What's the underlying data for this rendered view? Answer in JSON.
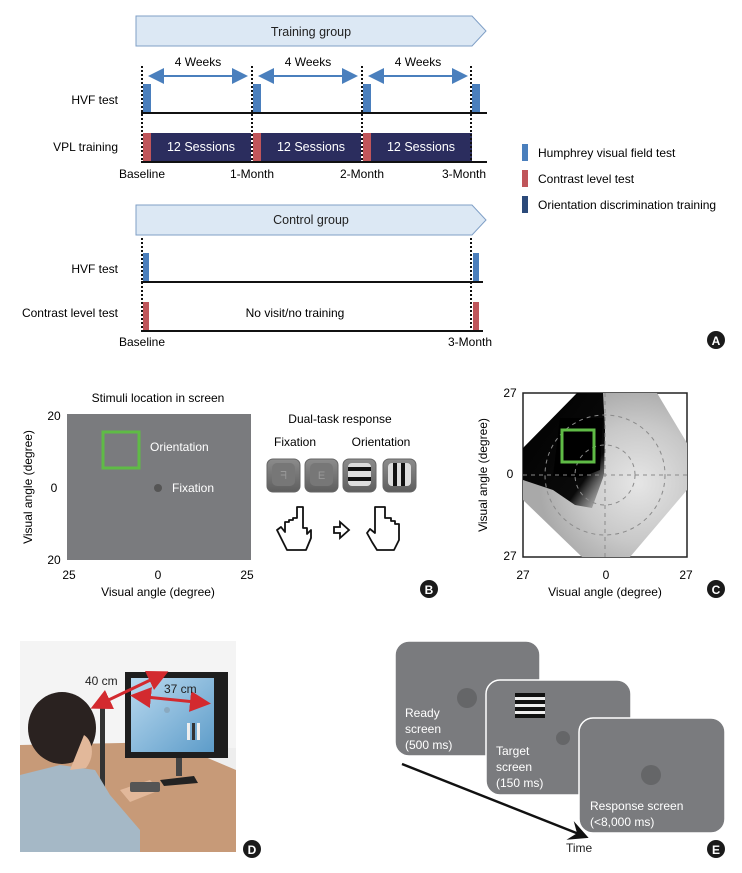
{
  "colors": {
    "hvf": "#4a7fbd",
    "contrast": "#c0555a",
    "training": "#2b2d5e",
    "banner_fill": "#dce8f4",
    "banner_stroke": "#7f9fc6",
    "arrow": "#4a7fbd",
    "screen_gray": "#7a7b7e",
    "green_box": "#5fbb46",
    "red_arrow": "#d32a2f",
    "badge": "#1a1a1a"
  },
  "panel_a": {
    "badge": "A",
    "training": {
      "banner": "Training group",
      "intervals": [
        "4 Weeks",
        "4 Weeks",
        "4 Weeks"
      ],
      "rows": [
        "HVF test",
        "VPL training"
      ],
      "sessions": [
        "12 Sessions",
        "12 Sessions",
        "12 Sessions"
      ],
      "timepoints": [
        "Baseline",
        "1-Month",
        "2-Month",
        "3-Month"
      ]
    },
    "control": {
      "banner": "Control group",
      "rows": [
        "HVF test",
        "Contrast level test"
      ],
      "middle_text": "No visit/no training",
      "timepoints": [
        "Baseline",
        "3-Month"
      ]
    },
    "legend": [
      {
        "label": "Humphrey visual field test",
        "color_key": "hvf"
      },
      {
        "label": "Contrast level test",
        "color_key": "contrast"
      },
      {
        "label": "Orientation discrimination training",
        "color_key": "training"
      }
    ]
  },
  "panel_b": {
    "badge": "B",
    "title": "Stimuli location in screen",
    "ylabel": "Visual angle (degree)",
    "xlabel": "Visual angle (degree)",
    "yticks": [
      "20",
      "0",
      "20"
    ],
    "xticks": [
      "25",
      "0",
      "25"
    ],
    "orientation_label": "Orientation",
    "fixation_label": "Fixation",
    "response_title": "Dual-task response",
    "response_fixation": "Fixation",
    "response_orientation": "Orientation",
    "key_glyphs": [
      "ᖷ",
      "E"
    ]
  },
  "panel_c": {
    "badge": "C",
    "ylabel": "Visual angle (degree)",
    "xlabel": "Visual angle (degree)",
    "yticks": [
      "27",
      "0",
      "27"
    ],
    "xticks": [
      "27",
      "0",
      "27"
    ]
  },
  "panel_d": {
    "badge": "D",
    "distance_eye": "40 cm",
    "distance_screen": "37 cm"
  },
  "panel_e": {
    "badge": "E",
    "screens": [
      {
        "name": "Ready",
        "line2": "screen",
        "duration": "(500 ms)"
      },
      {
        "name": "Target",
        "line2": "screen",
        "duration": "(150 ms)"
      },
      {
        "name": "Response screen",
        "line2": "",
        "duration": "(<8,000 ms)"
      }
    ],
    "time_label": "Time"
  }
}
